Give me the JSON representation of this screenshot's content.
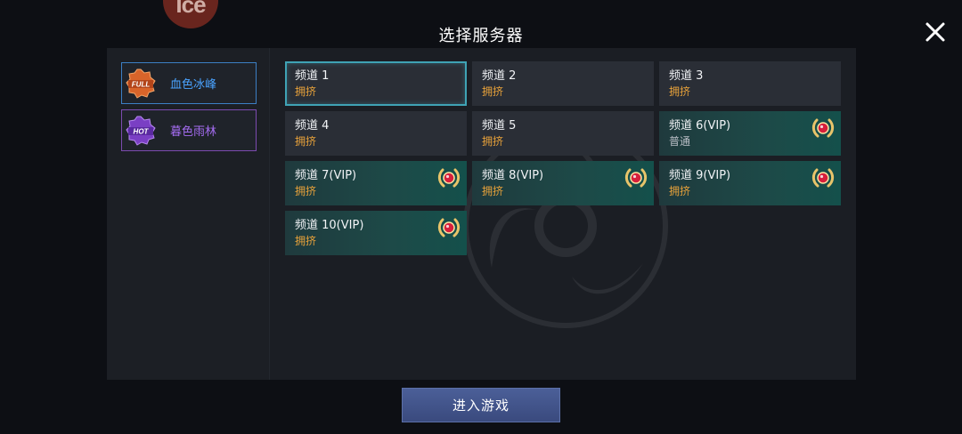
{
  "logo": {
    "text": "Ice"
  },
  "dialog": {
    "title": "选择服务器"
  },
  "regions": [
    {
      "label": "血色冰峰",
      "badge": "FULL",
      "badge_color": "#d8642a"
    },
    {
      "label": "暮色雨林",
      "badge": "HOT",
      "badge_color": "#7a3fc4"
    }
  ],
  "channels": [
    {
      "name": "频道 1",
      "status": "拥挤",
      "vip": false,
      "selected": true
    },
    {
      "name": "频道 2",
      "status": "拥挤",
      "vip": false,
      "selected": false
    },
    {
      "name": "频道 3",
      "status": "拥挤",
      "vip": false,
      "selected": false
    },
    {
      "name": "频道 4",
      "status": "拥挤",
      "vip": false,
      "selected": false
    },
    {
      "name": "频道 5",
      "status": "拥挤",
      "vip": false,
      "selected": false
    },
    {
      "name": "频道 6(VIP)",
      "status": "普通",
      "vip": true,
      "selected": false
    },
    {
      "name": "频道 7(VIP)",
      "status": "拥挤",
      "vip": true,
      "selected": false
    },
    {
      "name": "频道 8(VIP)",
      "status": "拥挤",
      "vip": true,
      "selected": false
    },
    {
      "name": "频道 9(VIP)",
      "status": "拥挤",
      "vip": true,
      "selected": false
    },
    {
      "name": "频道 10(VIP)",
      "status": "拥挤",
      "vip": true,
      "selected": false
    }
  ],
  "footer": {
    "enter_label": "进入游戏"
  },
  "icons": {
    "close": "close-icon",
    "vip": "vip-laurel-icon",
    "watermark": "emblem-watermark-icon"
  }
}
